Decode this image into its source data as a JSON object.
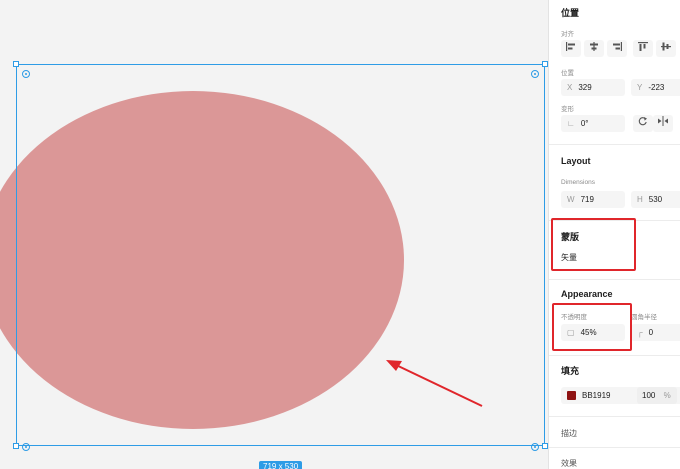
{
  "canvas": {
    "size_badge": "719 x 530",
    "fill_color": "#BB1919",
    "selection_color": "#2E9CE6"
  },
  "panel": {
    "position": {
      "title": "位置",
      "align_label": "对齐",
      "position_label": "位置",
      "x_prefix": "X",
      "x_value": "329",
      "y_prefix": "Y",
      "y_value": "-223",
      "transform_label": "变形",
      "rotation_value": "0°"
    },
    "layout": {
      "title": "Layout",
      "dimensions_label": "Dimensions",
      "w_prefix": "W",
      "w_value": "719",
      "h_prefix": "H",
      "h_value": "530"
    },
    "mask": {
      "title": "蒙版",
      "value": "矢量"
    },
    "appearance": {
      "title": "Appearance",
      "opacity_label": "不透明度",
      "opacity_value": "45%",
      "corner_label": "圆角半径",
      "corner_value": "0"
    },
    "fill": {
      "title": "填充",
      "hex": "BB1919",
      "opacity": "100",
      "unit": "%"
    },
    "stroke": {
      "title": "描边"
    },
    "effects": {
      "title": "效果"
    }
  }
}
